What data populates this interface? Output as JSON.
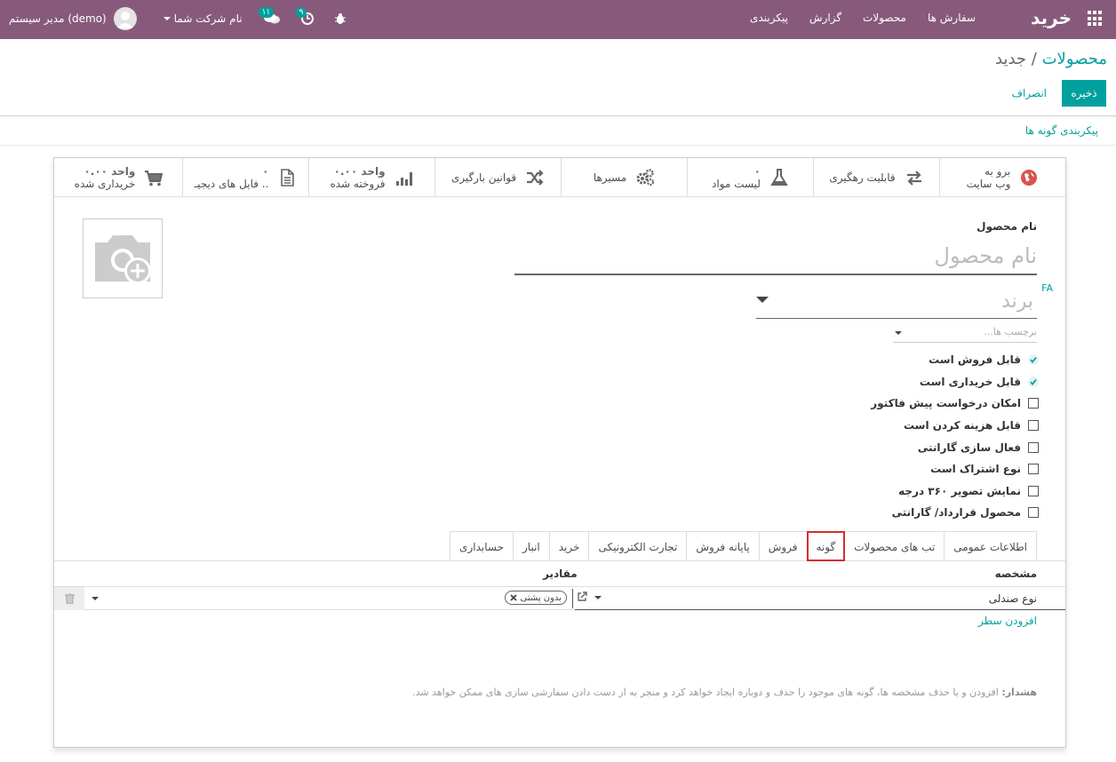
{
  "navbar": {
    "brand": "خرید",
    "menu": [
      "سفارش ها",
      "محصولات",
      "گزارش",
      "پیکربندی"
    ],
    "company": "نام شرکت شما",
    "user": "مدیر سیستم (demo)",
    "messages_count": "۱۱",
    "activities_count": "۹",
    "accent": "#875a7b"
  },
  "breadcrumb": {
    "parent": "محصولات",
    "separator": "/",
    "current": "جدید"
  },
  "actions": {
    "save": "ذخیره",
    "discard": "انصراف"
  },
  "variant_config_link": "پیکربندی گونه ها",
  "smart_buttons": [
    {
      "icon": "globe-icon",
      "line1": "برو به",
      "line2": "وب سایت"
    },
    {
      "icon": "exchange-icon",
      "line1": "قابلیت رهگیری",
      "line2": ""
    },
    {
      "icon": "flask-icon",
      "line1": "۰",
      "line2": "لیست مواد"
    },
    {
      "icon": "cogs-icon",
      "line1": "مسیرها",
      "line2": ""
    },
    {
      "icon": "shuffle-icon",
      "line1": "قوانین بارگیری",
      "line2": ""
    },
    {
      "icon": "bar-chart-icon",
      "line1": "۰.۰۰ واحد",
      "line2": "فروخته شده"
    },
    {
      "icon": "file-icon",
      "line1": "۰",
      "line2": "فایل های دیجیـ .."
    },
    {
      "icon": "cart-icon",
      "line1": "۰.۰۰ واحد",
      "line2": "خریداری شده"
    }
  ],
  "form": {
    "name_label": "نام محصول",
    "name_placeholder": "نام محصول",
    "lang": "FA",
    "brand_placeholder": "برند",
    "tags_placeholder": "برچسب ها...",
    "checkboxes": [
      {
        "label": "قابل فروش است",
        "checked": true
      },
      {
        "label": "قابل خریداری است",
        "checked": true
      },
      {
        "label": "امکان درخواست پیش فاکتور",
        "checked": false
      },
      {
        "label": "قابل هزینه کردن است",
        "checked": false
      },
      {
        "label": "فعال سازی گارانتی",
        "checked": false
      },
      {
        "label": "نوع اشتراک است",
        "checked": false
      },
      {
        "label": "نمایش تصویر ۳۶۰ درجه",
        "checked": false
      },
      {
        "label": "محصول قرارداد/ گارانتی",
        "checked": false
      }
    ]
  },
  "tabs": [
    "اطلاعات عمومی",
    "تب های محصولات",
    "گونه",
    "فروش",
    "پایانه فروش",
    "تجارت الکترونیکی",
    "خرید",
    "انبار",
    "حسابداری"
  ],
  "active_tab": "گونه",
  "variants_table": {
    "col_attribute": "مشخصه",
    "col_values": "مقادیر",
    "rows": [
      {
        "attribute": "نوع صندلی",
        "values": [
          "بدون پشتی"
        ]
      }
    ],
    "add_line": "افزودن سطر"
  },
  "warning": {
    "label": "هشدار:",
    "text": "افزودن و یا حذف مشخصه ها، گونه های موجود را حذف و دوباره ایجاد خواهد کرد و منجر به از دست دادن سفارشی سازی های ممکن خواهد شد."
  }
}
